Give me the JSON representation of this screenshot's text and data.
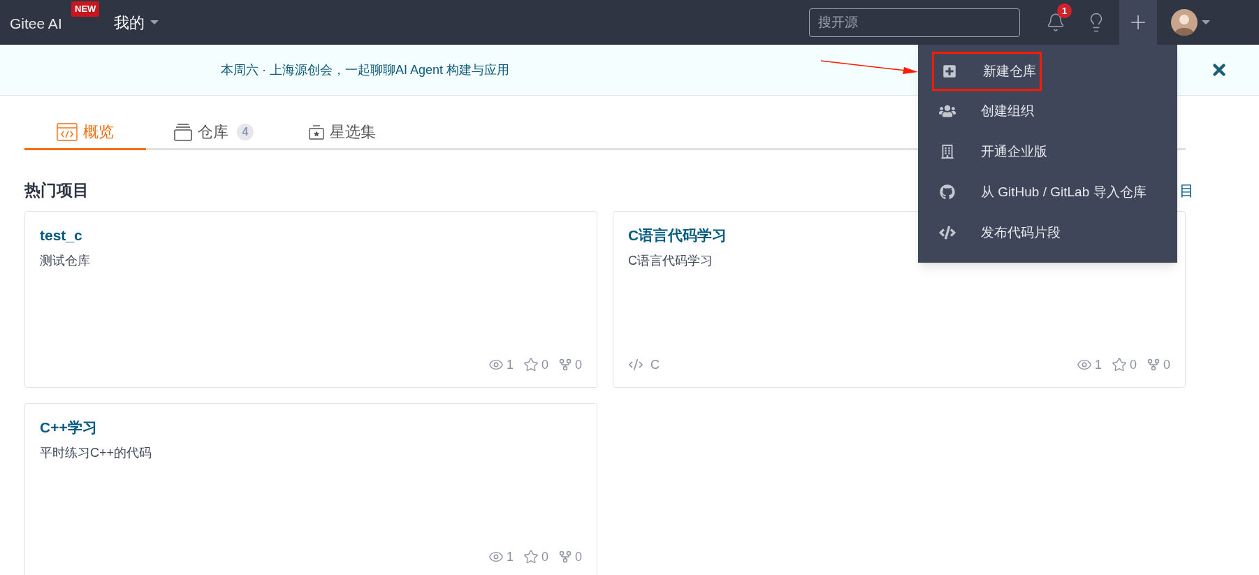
{
  "topbar": {
    "brand": "Gitee AI",
    "brand_badge": "NEW",
    "menu": "我的",
    "search": {
      "placeholder": "搜开源"
    },
    "notifications": {
      "count": "1"
    }
  },
  "banner": {
    "text": "本周六 · 上海源创会，一起聊聊AI Agent 构建与应用"
  },
  "tabs": [
    {
      "label": "概览",
      "kind": "overview",
      "selected": true
    },
    {
      "label": "仓库",
      "kind": "repos",
      "count": "4",
      "selected": false
    },
    {
      "label": "星选集",
      "kind": "stars",
      "selected": false
    }
  ],
  "section": {
    "title": "热门项目",
    "link": "目"
  },
  "cards": [
    {
      "name": "test_c",
      "description": "测试仓库",
      "watches": "1",
      "stars": "0",
      "forks": "0"
    },
    {
      "name": "C语言代码学习",
      "description": "C语言代码学习",
      "language": "C",
      "watches": "1",
      "stars": "0",
      "forks": "0"
    },
    {
      "name": "C++学习",
      "description": "平时练习C++的代码",
      "watches": "1",
      "stars": "0",
      "forks": "0"
    }
  ],
  "dropdown": {
    "items": [
      {
        "label": "新建仓库",
        "kind": "new-repo",
        "highlighted": true
      },
      {
        "label": "创建组织",
        "kind": "org",
        "highlighted": false
      },
      {
        "label": "开通企业版",
        "kind": "enterprise",
        "highlighted": false
      },
      {
        "label": "从 GitHub / GitLab 导入仓库",
        "kind": "import",
        "highlighted": false
      },
      {
        "label": "发布代码片段",
        "kind": "snippet",
        "highlighted": false
      }
    ]
  }
}
